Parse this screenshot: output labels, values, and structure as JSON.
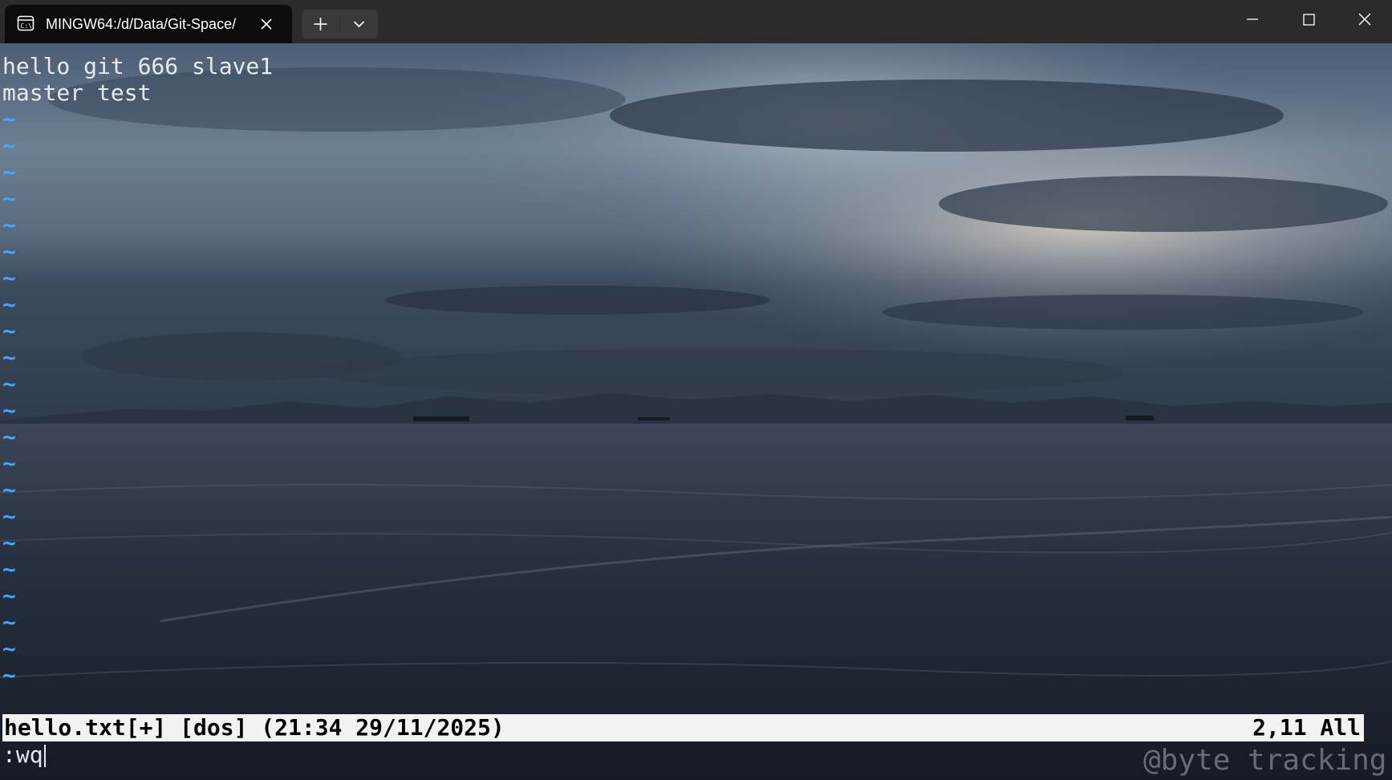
{
  "window": {
    "tab_title": "MINGW64:/d/Data/Git-Space/",
    "tab_icon": "terminal-icon",
    "buttons": {
      "new_tab": "plus-icon",
      "dropdown": "chevron-down-icon",
      "minimize": "minimize-icon",
      "maximize": "maximize-icon",
      "close": "close-icon"
    }
  },
  "editor": {
    "lines": [
      "hello git 666 slave1",
      "master test"
    ],
    "tilde_char": "~",
    "status_left": "hello.txt[+] [dos] (21:34 29/11/2025)",
    "status_right": "2,11 All",
    "command": ":wq"
  },
  "watermark": "@byte tracking",
  "colors": {
    "tilde": "#4aa3ff",
    "text": "#e7e9ec",
    "statusline_bg": "#f2f2f2",
    "titlebar_bg": "#2b2b2b",
    "tab_bg": "#0c0c0c"
  }
}
